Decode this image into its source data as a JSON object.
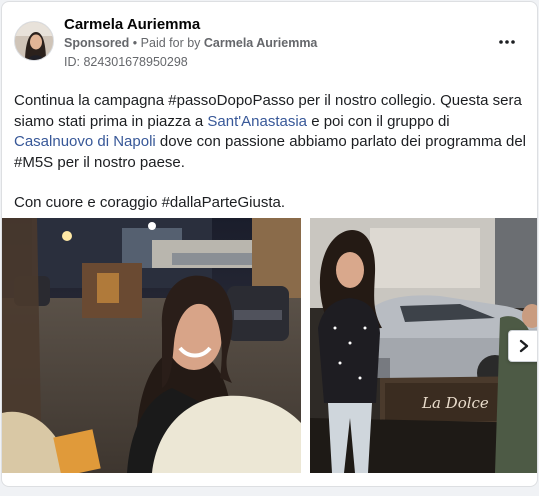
{
  "post": {
    "author": "Carmela Auriemma",
    "sponsored_label": "Sponsored",
    "separator": "•",
    "paid_for_label": "Paid for by",
    "paid_for_by": "Carmela Auriemma",
    "ad_id": "ID: 824301678950298",
    "more_icon": "more-horizontal-icon",
    "text": {
      "p1_part1": "Continua la campagna #passoDopoPasso per il nostro collegio. Questa sera siamo stati prima in piazza a ",
      "p1_link1": "Sant'Anastasia",
      "p1_part2": " e poi con il gruppo di ",
      "p1_link2": "Casalnuovo di Napoli",
      "p1_part3": " dove con passione abbiamo parlato dei programma del #M5S per il nostro paese.",
      "p2": "Con cuore e coraggio #dallaParteGiusta."
    },
    "photo2_sign": "La Dolce",
    "carousel_next_icon": "chevron-right-icon"
  },
  "colors": {
    "link": "#385898",
    "secondary_text": "#65676b",
    "card_border": "#dddfe2"
  }
}
